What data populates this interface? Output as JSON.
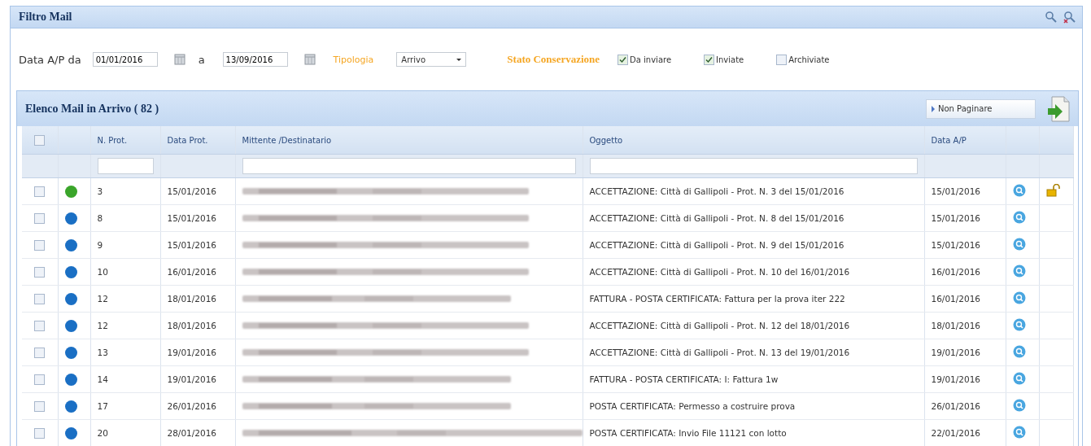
{
  "panel": {
    "title": "Filtro Mail"
  },
  "filters": {
    "date_from_label": "Data A/P da",
    "date_from": "01/01/2016",
    "date_to_label": "a",
    "date_to": "13/09/2016",
    "type_label": "Tipologia",
    "type_value": "Arrivo",
    "status_label": "Stato Conservazione",
    "checkboxes": [
      {
        "label": "Da inviare",
        "checked": true
      },
      {
        "label": "Inviate",
        "checked": true
      },
      {
        "label": "Archiviate",
        "checked": false
      }
    ]
  },
  "grid": {
    "title": "Elenco Mail in Arrivo ( 82 )",
    "select_all_checked": false,
    "button": "Non Paginare",
    "columns": [
      "N. Prot.",
      "Data Prot.",
      "Mittente /Destinatario",
      "Oggetto",
      "Data A/P"
    ],
    "rows": [
      {
        "checked": false,
        "color": "#3aa52a",
        "prot": "3",
        "date": "15/01/2016",
        "subject": "ACCETTAZIONE: Città di Gallipoli - Prot. N. 3 del 15/01/2016",
        "date_ap": "15/01/2016",
        "padlock": true
      },
      {
        "checked": false,
        "color": "#1a6fc4",
        "prot": "8",
        "date": "15/01/2016",
        "subject": "ACCETTAZIONE: Città di Gallipoli - Prot. N. 8 del 15/01/2016",
        "date_ap": "15/01/2016",
        "padlock": false
      },
      {
        "checked": false,
        "color": "#1a6fc4",
        "prot": "9",
        "date": "15/01/2016",
        "subject": "ACCETTAZIONE: Città di Gallipoli - Prot. N. 9 del 15/01/2016",
        "date_ap": "15/01/2016",
        "padlock": false
      },
      {
        "checked": false,
        "color": "#1a6fc4",
        "prot": "10",
        "date": "16/01/2016",
        "subject": "ACCETTAZIONE: Città di Gallipoli - Prot. N. 10 del 16/01/2016",
        "date_ap": "16/01/2016",
        "padlock": false
      },
      {
        "checked": false,
        "color": "#1a6fc4",
        "prot": "12",
        "date": "18/01/2016",
        "subject": "FATTURA - POSTA CERTIFICATA: Fattura per la prova iter 222",
        "date_ap": "16/01/2016",
        "padlock": false
      },
      {
        "checked": false,
        "color": "#1a6fc4",
        "prot": "12",
        "date": "18/01/2016",
        "subject": "ACCETTAZIONE: Città di Gallipoli - Prot. N. 12 del 18/01/2016",
        "date_ap": "18/01/2016",
        "padlock": false
      },
      {
        "checked": false,
        "color": "#1a6fc4",
        "prot": "13",
        "date": "19/01/2016",
        "subject": "ACCETTAZIONE: Città di Gallipoli - Prot. N. 13 del 19/01/2016",
        "date_ap": "19/01/2016",
        "padlock": false
      },
      {
        "checked": false,
        "color": "#1a6fc4",
        "prot": "14",
        "date": "19/01/2016",
        "subject": "FATTURA - POSTA CERTIFICATA: I: Fattura 1w",
        "date_ap": "19/01/2016",
        "padlock": false
      },
      {
        "checked": false,
        "color": "#1a6fc4",
        "prot": "17",
        "date": "26/01/2016",
        "subject": "POSTA CERTIFICATA: Permesso a costruire prova",
        "date_ap": "26/01/2016",
        "padlock": false
      },
      {
        "checked": false,
        "color": "#1a6fc4",
        "prot": "20",
        "date": "28/01/2016",
        "subject": "POSTA CERTIFICATA: Invio File 11121 con lotto",
        "date_ap": "22/01/2016",
        "padlock": false
      }
    ]
  }
}
